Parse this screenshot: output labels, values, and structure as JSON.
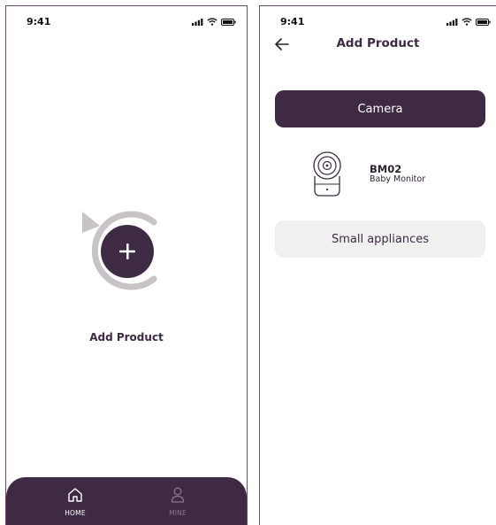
{
  "status_bar": {
    "time": "9:41"
  },
  "home_screen": {
    "add_product_label": "Add Product",
    "tabs": [
      {
        "label": "HOME",
        "icon": "home-icon",
        "active": true
      },
      {
        "label": "MINE",
        "icon": "user-icon",
        "active": false
      }
    ]
  },
  "add_product_screen": {
    "title": "Add Product",
    "categories": [
      {
        "label": "Camera",
        "selected": true
      },
      {
        "label": "Small appliances",
        "selected": false
      }
    ],
    "products": [
      {
        "name": "BM02",
        "description": "Baby Monitor",
        "icon": "baby-monitor-camera-icon"
      }
    ]
  },
  "colors": {
    "accent": "#3f2a43",
    "arc": "#c8c3c7",
    "tab_inactive": "#8c7790",
    "secondary_button": "#f1f0f0"
  }
}
